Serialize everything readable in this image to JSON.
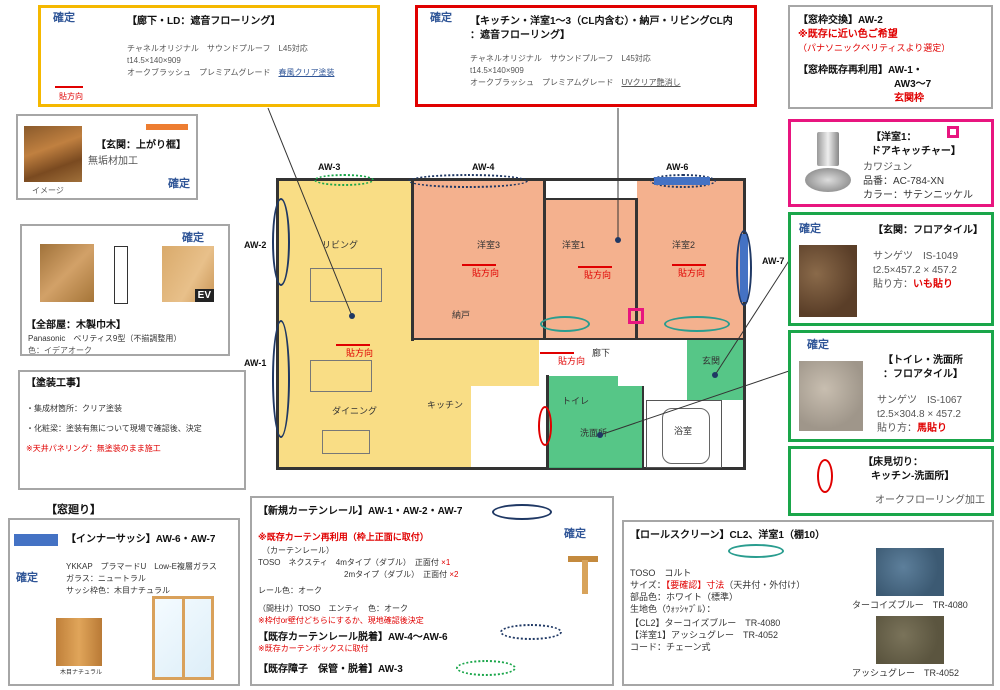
{
  "hallway": {
    "confirmed": "確定",
    "title": "【廊下・LD：遮音フローリング】",
    "line1": "チャネルオリジナル　サウンドプルーフ　L45対応",
    "line2": "t14.5×140×909",
    "line3a": "オークブラッシュ　プレミアムグレード　",
    "line3b": "春風クリア塗装",
    "dir": "貼方向"
  },
  "kitchen": {
    "confirmed": "確定",
    "title1": "【キッチン・洋室1～3（CL内含む）・納戸・リビングCL内",
    "title2": "：遮音フローリング】",
    "line1": "チャネルオリジナル　サウンドプルーフ　L45対応",
    "line2": "t14.5×140×909",
    "line3a": "オークブラッシュ　プレミアムグレード　",
    "line3b": "UVクリア艶消し"
  },
  "frame_swap": {
    "title": "【窓枠交換】AW-2",
    "note1": "※既存に近い色ご希望",
    "note2": "（パナソニックベリティスより選定）",
    "title2": "【窓枠既存再利用】AW-1・",
    "line2": "AW3～7",
    "line3": "玄関枠"
  },
  "entrance_frame": {
    "title": "【玄関：上がり框】",
    "sub": "無垢材加工",
    "image_label": "イメージ",
    "confirmed": "確定"
  },
  "baseboard": {
    "confirmed": "確定",
    "title": "【全部屋：木製巾木】",
    "line1": "Panasonic　ベリティス9型（不揃調整用）",
    "line2": "色：イデアオーク",
    "ev": "EV"
  },
  "paint": {
    "title": "【塗装工事】",
    "item1": "・集成材箇所：クリア塗装",
    "item2": "・化粧梁：塗装有無について現場で確認後、決定",
    "item3": "※天井パネリング：無塗装のまま施工"
  },
  "window_area": {
    "title": "【窓廻り】",
    "sash_title": "【インナーサッシ】AW-6・AW-7",
    "confirmed": "確定",
    "line1": "YKKAP　プラマードU　Low-E複層ガラス",
    "line2": "ガラス：ニュートラル",
    "line3": "サッシ枠色：木目ナチュラル",
    "swatch_label": "木目ナチュラル"
  },
  "curtain": {
    "title": "【新規カーテンレール】AW-1・AW-2・AW-7",
    "confirmed": "確定",
    "reuse": "※既存カーテン再利用（枠上正面に取付）",
    "sub": "（カーテンレール）",
    "line1": "TOSO　ネクスティ　4mタイプ（ダブル）　正面付",
    "mark1": "×1",
    "line2": "2mタイプ（ダブル）　正面付",
    "mark2": "×2",
    "color": "レール色：オーク",
    "bracket": "（間柱け）TOSO　エンティ　色：オーク",
    "bracket_note": "※枠付or壁付どちらにするか、現地確認後決定",
    "remove_title": "【既存カーテンレール脱着】AW-4～AW-6",
    "remove_note": "※既存カーテンボックスに取付",
    "shoji": "【既存障子　保管・脱着】AW-3"
  },
  "door_catcher": {
    "title": "【洋室1：",
    "title2": "ドアキャッチャー】",
    "maker": "カワジュン",
    "part": "品番：AC-784-XN",
    "color": "カラー：サテンニッケル"
  },
  "entrance_tile": {
    "confirmed": "確定",
    "title": "【玄関：フロアタイル】",
    "line1": "サンゲツ　IS-1049",
    "line2": "t2.5×457.2 × 457.2",
    "line3a": "貼り方：",
    "line3b": "いも貼り"
  },
  "toilet_tile": {
    "confirmed": "確定",
    "title1": "【トイレ・洗面所",
    "title2": "：フロアタイル】",
    "line1": "サンゲツ　IS-1067",
    "line2": "t2.5×304.8 × 457.2",
    "line3a": "貼り方：",
    "line3b": "馬貼り"
  },
  "floor_cut": {
    "title1": "【床見切り：",
    "title2": "キッチン-洗面所】",
    "line1": "オークフローリング加工"
  },
  "roll_screen": {
    "title": "【ロールスクリーン】CL2、洋室1（棚10）",
    "line1": "TOSO　コルト",
    "line2a": "サイズ：",
    "line2b": "【要確認】寸法",
    "line2c": "（天井付・外付け）",
    "line3": "部品色：ホワイト（標準）",
    "line4": "生地色（ｳｫｯｼｬﾌﾞﾙ）：",
    "line5": "【CL2】ターコイズブルー　TR-4080",
    "line6": "【洋室1】アッシュグレー　TR-4052",
    "line7": "コード：チェーン式",
    "swatch1": "ターコイズブルー　TR-4080",
    "swatch2": "アッシュグレー　TR-4052"
  },
  "plan": {
    "aw1": "AW-1",
    "aw2": "AW-2",
    "aw3": "AW-3",
    "aw4": "AW-4",
    "aw6": "AW-6",
    "aw7": "AW-7",
    "living": "リビング",
    "dining": "ダイニング",
    "kitchen": "キッチン",
    "storage": "納戸",
    "room1": "洋室1",
    "room2": "洋室2",
    "room3": "洋室3",
    "entrance": "玄関",
    "hall": "廊下",
    "bath": "浴室",
    "wash": "洗面所",
    "toilet": "トイレ",
    "dir": "貼方向"
  },
  "colors": {
    "yellow_zone": "#f8d770",
    "orange_zone": "#f3a882",
    "green_zone": "#44c07a",
    "curtain_blue": "#4472c4"
  }
}
